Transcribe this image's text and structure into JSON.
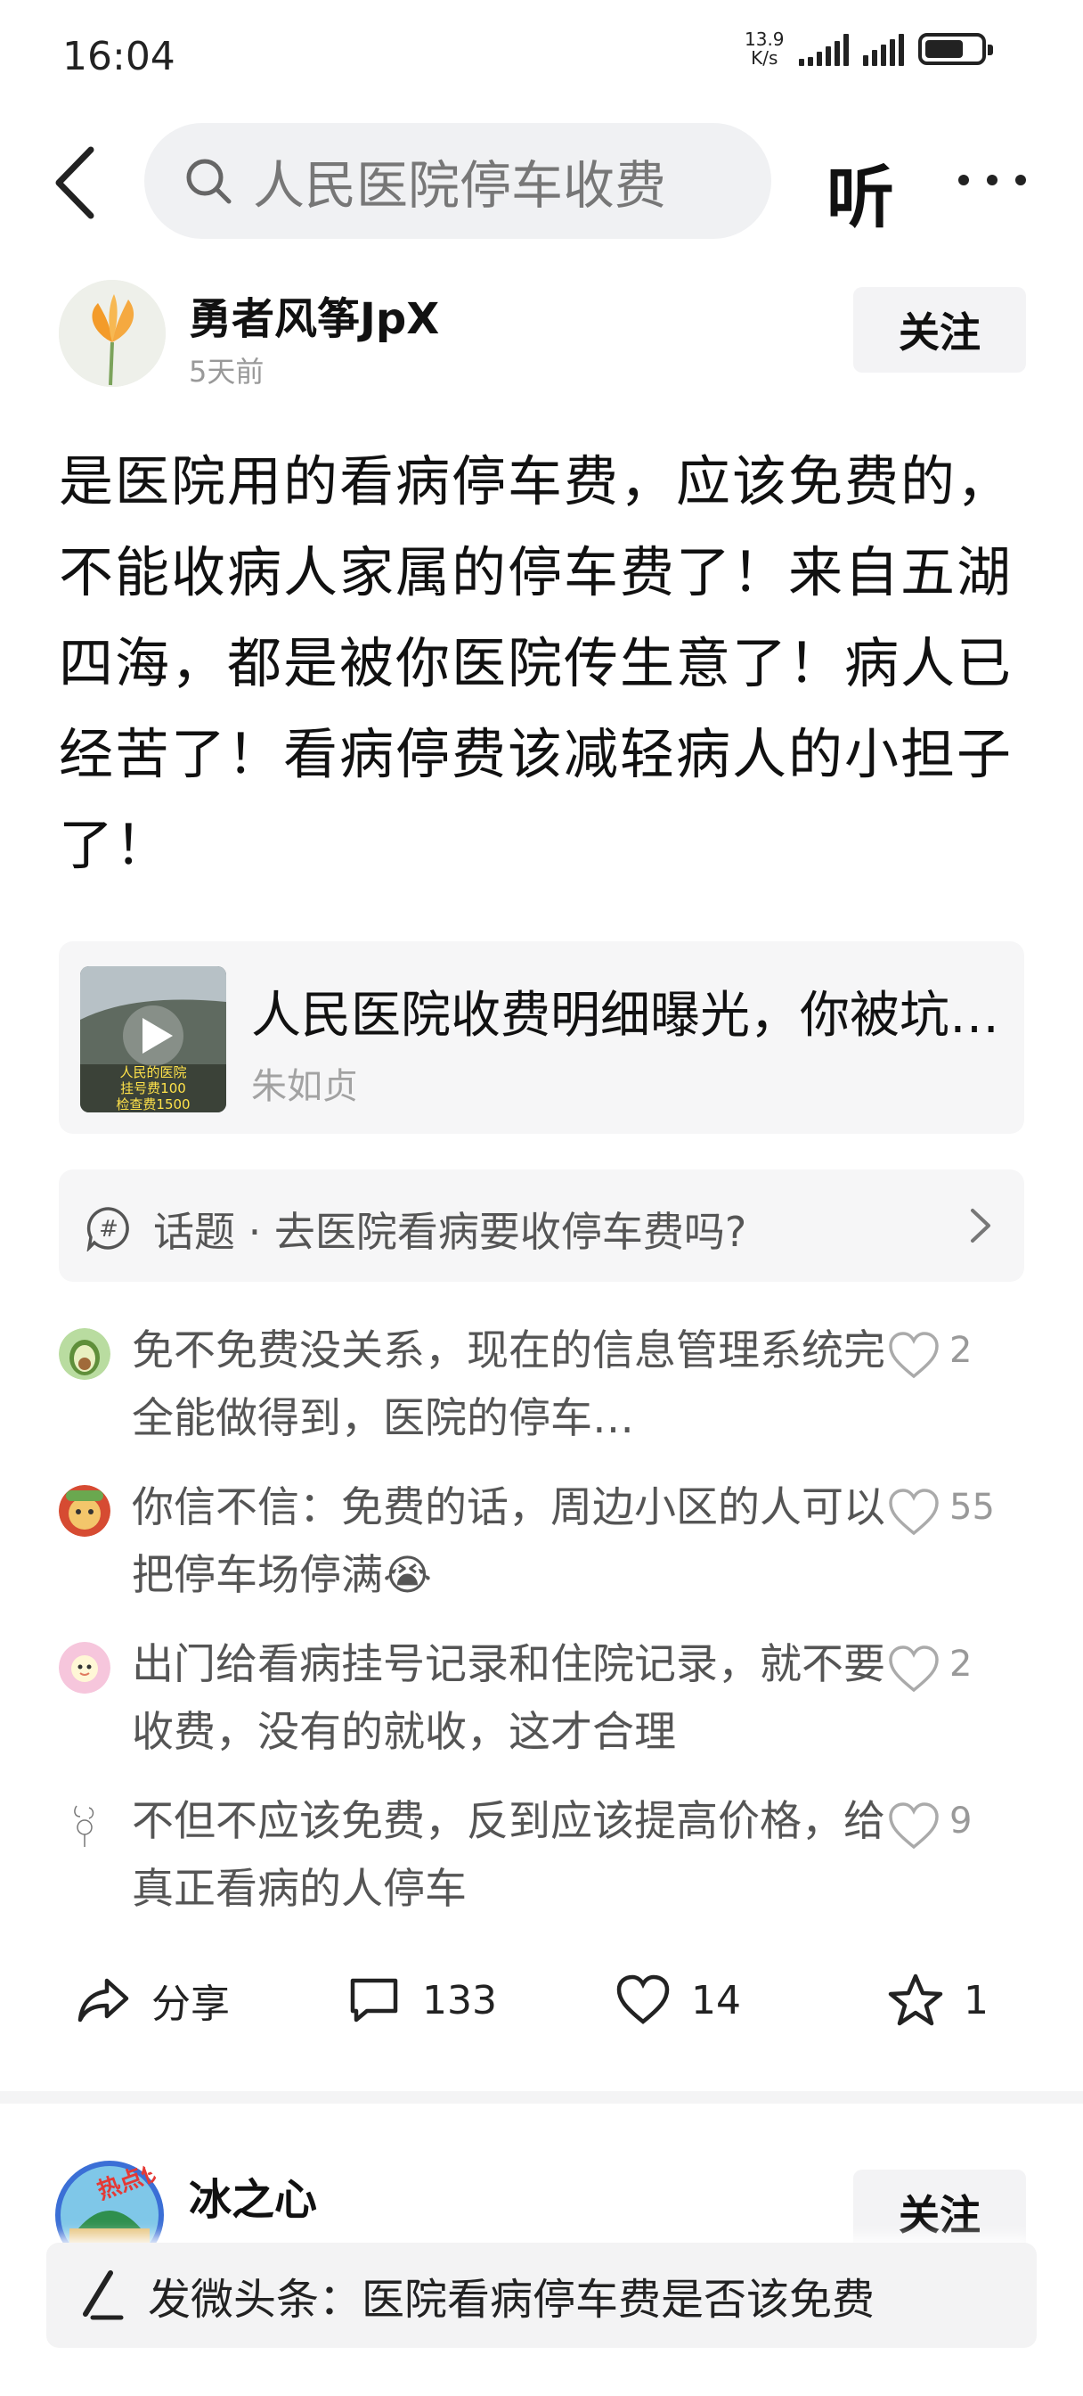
{
  "status_bar": {
    "time": "16:04",
    "net_speed_value": "13.9",
    "net_speed_unit": "K/s",
    "battery_level": 0.7
  },
  "top_nav": {
    "search_text": "人民医院停车收费",
    "listen_label": "听"
  },
  "post": {
    "author": "勇者风筝JpX",
    "time": "5天前",
    "follow_label": "关注",
    "text": "是医院用的看病停车费，应该免费的，不能收病人家属的停车费了！来自五湖四海，都是被你医院传生意了！病人已经苦了！看病停费该减轻病人的小担子了！",
    "video": {
      "title": "人民医院收费明细曝光，你被坑了吗",
      "author": "朱如贞",
      "thumb_caption_1": "人民的医院",
      "thumb_caption_2": "挂号费100",
      "thumb_caption_3": "检查费1500"
    },
    "topic": "话题 · 去医院看病要收停车费吗?",
    "comments": [
      {
        "text": "免不免费没关系，现在的信息管理系统完全能做得到，医院的停车…",
        "likes": "2"
      },
      {
        "text": "你信不信：免费的话，周边小区的人可以把停车场停满😭",
        "likes": "55"
      },
      {
        "text": "出门给看病挂号记录和住院记录，就不要收费，没有的就收，这才合理",
        "likes": "2"
      },
      {
        "text": "不但不应该免费，反到应该提高价格，给真正看病的人停车",
        "likes": "9"
      }
    ],
    "actions": {
      "share_label": "分享",
      "comment_count": "133",
      "like_count": "14",
      "favorite_count": "1"
    }
  },
  "next_post": {
    "author": "冰之心",
    "badge": "热点侠",
    "follow_label": "关注"
  },
  "compose": {
    "text": "发微头条：医院看病停车费是否该免费"
  },
  "colors": {
    "text_primary": "#111111",
    "text_secondary": "#555555",
    "text_muted": "#999999",
    "card_bg": "#f6f6f7"
  }
}
